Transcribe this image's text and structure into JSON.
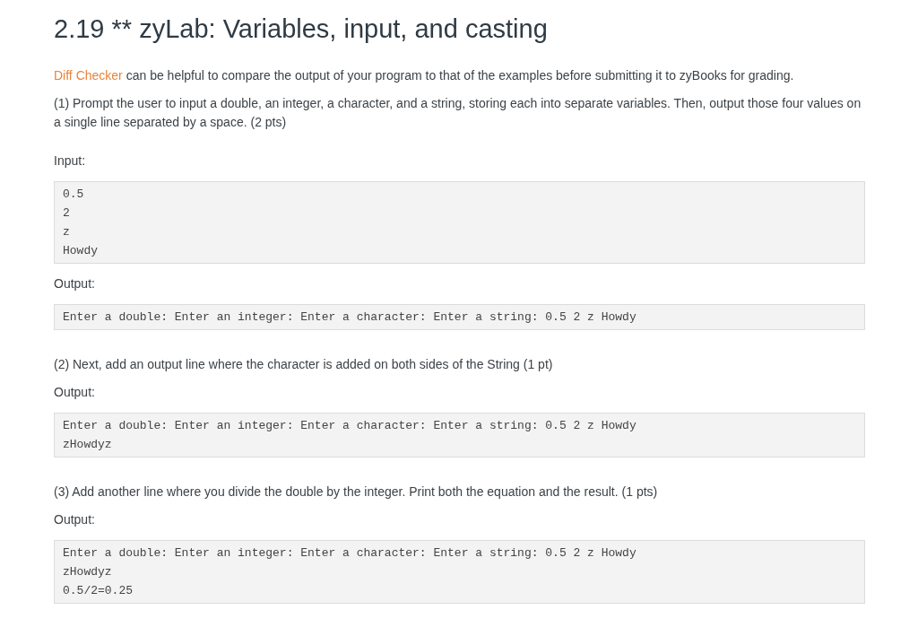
{
  "title": "2.19 ** zyLab: Variables, input, and casting",
  "intro": {
    "link": "Diff Checker",
    "text": "can be helpful to compare the output of your program to that of the examples before submitting it to zyBooks for grading."
  },
  "parts": [
    {
      "prompt": "(1) Prompt the user to input a double, an integer, a character, and a string, storing each into separate variables. Then, output those four values on a single line separated by a space. (2 pts)",
      "examples": [
        {
          "label": "Input:",
          "lines": [
            "0.5",
            "2",
            "z",
            "Howdy"
          ]
        },
        {
          "label": "Output:",
          "lines": [
            "Enter a double: Enter an integer: Enter a character: Enter a string: 0.5 2 z Howdy"
          ]
        }
      ]
    },
    {
      "prompt": "(2) Next, add an output line where the character is added on both sides of the String (1 pt)",
      "examples": [
        {
          "label": "Output:",
          "lines": [
            "Enter a double: Enter an integer: Enter a character: Enter a string: 0.5 2 z Howdy",
            "zHowdyz"
          ]
        }
      ]
    },
    {
      "prompt": "(3) Add another line where you divide the double by the integer. Print both the equation and the result. (1 pts)",
      "examples": [
        {
          "label": "Output:",
          "lines": [
            "Enter a double: Enter an integer: Enter a character: Enter a string: 0.5 2 z Howdy",
            "zHowdyz",
            "0.5/2=0.25"
          ]
        }
      ]
    }
  ]
}
